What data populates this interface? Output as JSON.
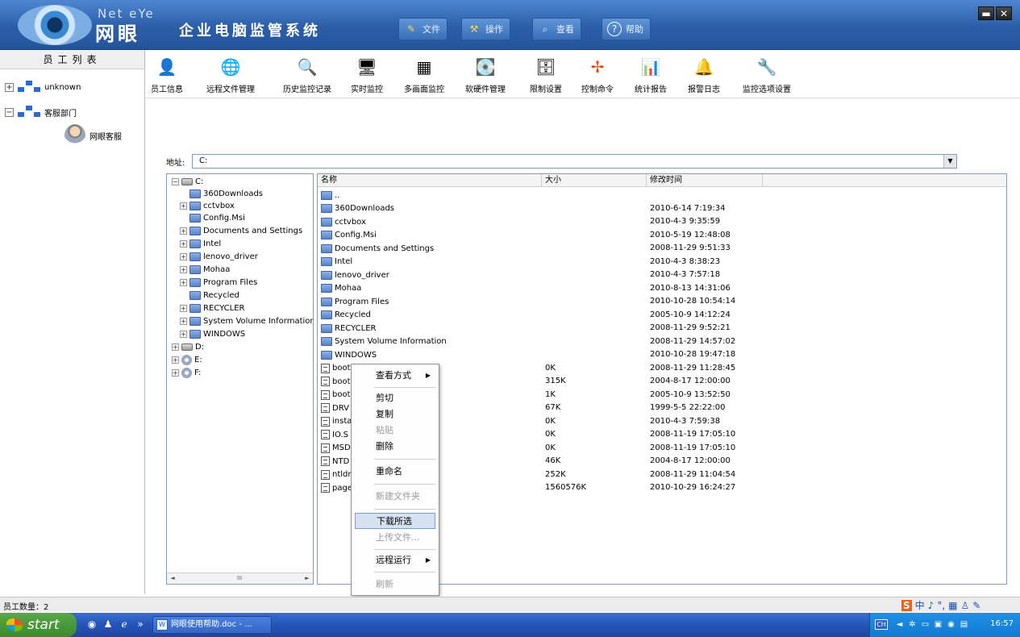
{
  "app": {
    "brand_en": "Net eYe",
    "brand_cn": "网眼",
    "title": "企业电脑监管系统",
    "colors": {
      "titlebar": "#2c5ea8",
      "selection": "#d6e1f3",
      "taskbar": "#2554b8"
    }
  },
  "menu": [
    {
      "label": "文件",
      "icon": "pencil-icon"
    },
    {
      "label": "操作",
      "icon": "tools-icon"
    },
    {
      "label": "查看",
      "icon": "magnifier-icon"
    },
    {
      "label": "帮助",
      "icon": "help-icon"
    }
  ],
  "window_controls": {
    "minimize": "▬",
    "close": "✕"
  },
  "employee_panel": {
    "header": "员工列表",
    "nodes": [
      {
        "label": "unknown",
        "expander": "+"
      },
      {
        "label": "客服部门",
        "expander": "−"
      },
      {
        "label": "网眼客服"
      }
    ]
  },
  "toolbar": [
    {
      "label": "员工信息",
      "icon": "employee-icon",
      "glyph": "👤"
    },
    {
      "label": "远程文件管理",
      "icon": "globe-icon",
      "glyph": "🌐"
    },
    {
      "label": "历史监控记录",
      "icon": "history-search-icon",
      "glyph": "🔍"
    },
    {
      "label": "实时监控",
      "icon": "monitor-icon",
      "glyph": "🖥"
    },
    {
      "label": "多画面监控",
      "icon": "multi-screen-icon",
      "glyph": "▦"
    },
    {
      "label": "软硬件管理",
      "icon": "hardware-icon",
      "glyph": "💽"
    },
    {
      "label": "限制设置",
      "icon": "restriction-icon",
      "glyph": "🗄"
    },
    {
      "label": "控制命令",
      "icon": "command-icon",
      "glyph": "✢"
    },
    {
      "label": "统计报告",
      "icon": "report-icon",
      "glyph": "📊"
    },
    {
      "label": "报警日志",
      "icon": "alarm-icon",
      "glyph": "🔔"
    },
    {
      "label": "监控选项设置",
      "icon": "settings-icon",
      "glyph": "🔧"
    }
  ],
  "address": {
    "label": "地址:",
    "value": "C:"
  },
  "folder_tree": {
    "items": [
      {
        "label": "C:",
        "type": "drive",
        "expander": "−"
      },
      {
        "label": "360Downloads",
        "type": "folder",
        "expander": ""
      },
      {
        "label": "cctvbox",
        "type": "folder",
        "expander": "+"
      },
      {
        "label": "Config.Msi",
        "type": "folder",
        "expander": ""
      },
      {
        "label": "Documents and Settings",
        "type": "folder",
        "expander": "+"
      },
      {
        "label": "Intel",
        "type": "folder",
        "expander": "+"
      },
      {
        "label": "lenovo_driver",
        "type": "folder",
        "expander": "+"
      },
      {
        "label": "Mohaa",
        "type": "folder",
        "expander": "+"
      },
      {
        "label": "Program Files",
        "type": "folder",
        "expander": "+"
      },
      {
        "label": "Recycled",
        "type": "folder",
        "expander": ""
      },
      {
        "label": "RECYCLER",
        "type": "folder",
        "expander": "+"
      },
      {
        "label": "System Volume Information",
        "type": "folder",
        "expander": "+"
      },
      {
        "label": "WINDOWS",
        "type": "folder",
        "expander": "+"
      },
      {
        "label": "D:",
        "type": "drive",
        "expander": "+"
      },
      {
        "label": "E:",
        "type": "cd",
        "expander": "+"
      },
      {
        "label": "F:",
        "type": "cd",
        "expander": "+"
      }
    ],
    "scroll_grip": "III",
    "scroll_left": "◄",
    "scroll_right": "►"
  },
  "file_list": {
    "columns": [
      "名称",
      "大小",
      "修改时间"
    ],
    "rows": [
      {
        "name": "..",
        "size": "",
        "modified": "",
        "kind": "folder"
      },
      {
        "name": "360Downloads",
        "size": "",
        "modified": "2010-6-14 7:19:34",
        "kind": "folder"
      },
      {
        "name": "cctvbox",
        "size": "",
        "modified": "2010-4-3 9:35:59",
        "kind": "folder"
      },
      {
        "name": "Config.Msi",
        "size": "",
        "modified": "2010-5-19 12:48:08",
        "kind": "folder"
      },
      {
        "name": "Documents and Settings",
        "size": "",
        "modified": "2008-11-29 9:51:33",
        "kind": "folder"
      },
      {
        "name": "Intel",
        "size": "",
        "modified": "2010-4-3 8:38:23",
        "kind": "folder"
      },
      {
        "name": "lenovo_driver",
        "size": "",
        "modified": "2010-4-3 7:57:18",
        "kind": "folder"
      },
      {
        "name": "Mohaa",
        "size": "",
        "modified": "2010-8-13 14:31:06",
        "kind": "folder"
      },
      {
        "name": "Program Files",
        "size": "",
        "modified": "2010-10-28 10:54:14",
        "kind": "folder"
      },
      {
        "name": "Recycled",
        "size": "",
        "modified": "2005-10-9 14:12:24",
        "kind": "folder"
      },
      {
        "name": "RECYCLER",
        "size": "",
        "modified": "2008-11-29 9:52:21",
        "kind": "folder"
      },
      {
        "name": "System Volume Information",
        "size": "",
        "modified": "2008-11-29 14:57:02",
        "kind": "folder"
      },
      {
        "name": "WINDOWS",
        "size": "",
        "modified": "2010-10-28 19:47:18",
        "kind": "folder"
      },
      {
        "name": "boot",
        "size": "0K",
        "modified": "2008-11-29 11:28:45",
        "kind": "file"
      },
      {
        "name": "boot",
        "size": "315K",
        "modified": "2004-8-17 12:00:00",
        "kind": "file"
      },
      {
        "name": "boot",
        "size": "1K",
        "modified": "2005-10-9 13:52:50",
        "kind": "file"
      },
      {
        "name": "DRV",
        "size": "67K",
        "modified": "1999-5-5 22:22:00",
        "kind": "file"
      },
      {
        "name": "insta",
        "size": "0K",
        "modified": "2010-4-3 7:59:38",
        "kind": "file"
      },
      {
        "name": "IO.S",
        "size": "0K",
        "modified": "2008-11-19 17:05:10",
        "kind": "file"
      },
      {
        "name": "MSD",
        "size": "0K",
        "modified": "2008-11-19 17:05:10",
        "kind": "file"
      },
      {
        "name": "NTD",
        "size": "46K",
        "modified": "2004-8-17 12:00:00",
        "kind": "file"
      },
      {
        "name": "ntldr",
        "size": "252K",
        "modified": "2008-11-29 11:04:54",
        "kind": "file"
      },
      {
        "name": "page",
        "size": "1560576K",
        "modified": "2010-10-29 16:24:27",
        "kind": "file"
      }
    ]
  },
  "context_menu": {
    "view_mode": "查看方式",
    "cut": "剪切",
    "copy": "复制",
    "paste": "粘贴",
    "delete": "删除",
    "rename": "重命名",
    "new_folder": "新建文件夹",
    "download_selected": "下载所选",
    "upload_file": "上传文件...",
    "remote_run": "远程运行",
    "refresh": "刷新",
    "submenu_arrow": "▶"
  },
  "status_bar": {
    "employee_count": "员工数量：2",
    "ime": [
      "S",
      "中",
      "♪",
      "°,",
      "▦",
      "♙",
      "✎"
    ]
  },
  "taskbar": {
    "start": "start",
    "task": "网眼使用帮助.doc - ...",
    "quicklaunch": [
      "◉",
      "♟",
      "ℯ",
      "»"
    ],
    "tray_lang": "CH",
    "tray_icons": [
      "◄",
      "✲",
      "▭",
      "▣",
      "◉",
      "▤"
    ],
    "clock": "16:57"
  }
}
